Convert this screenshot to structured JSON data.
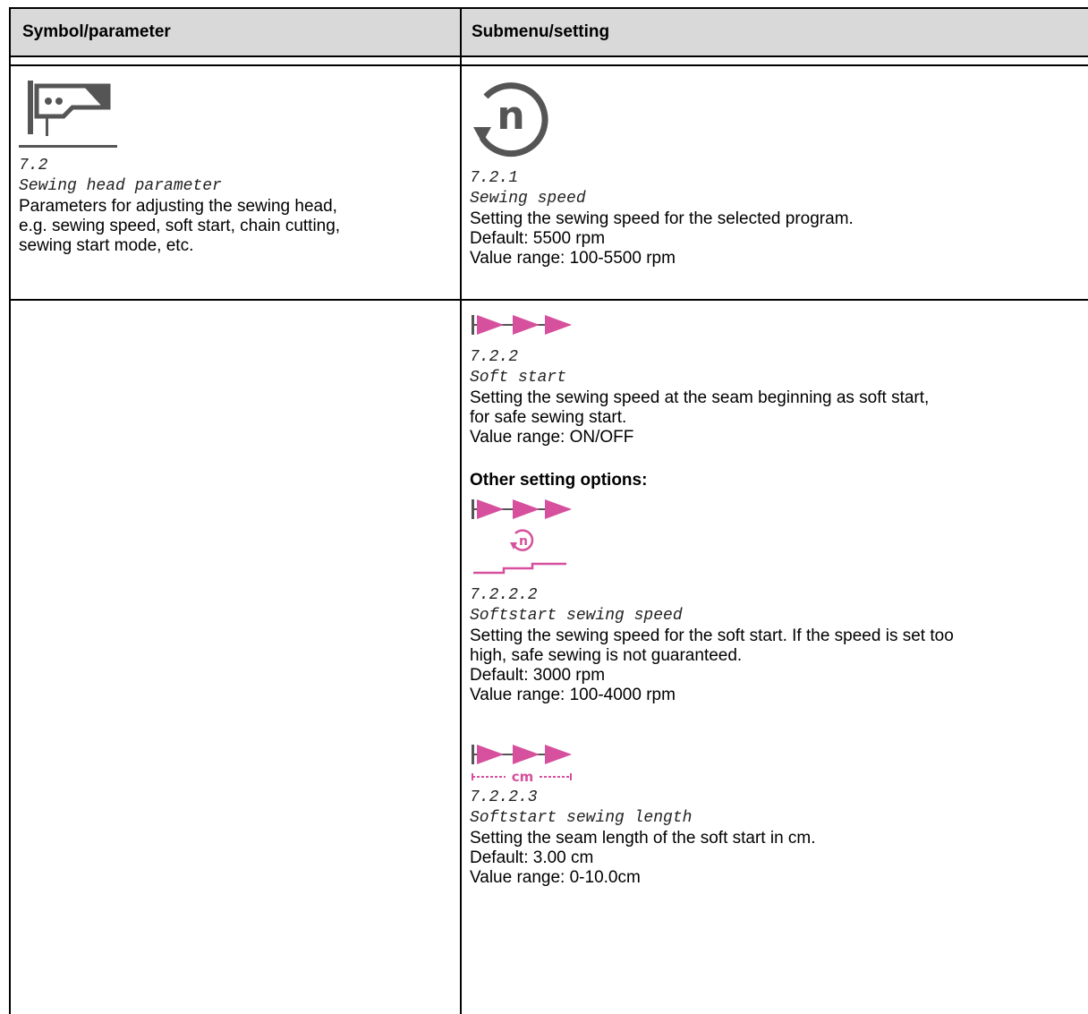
{
  "table": {
    "headers": [
      "Symbol/parameter",
      "Submenu/setting"
    ],
    "left": {
      "code": "7.2",
      "name": "Sewing head parameter",
      "description": [
        "Parameters for adjusting the sewing head,",
        "e.g. sewing speed, soft start, chain cutting,",
        "sewing start mode, etc."
      ],
      "icon": "sewing-head-icon"
    },
    "right": [
      {
        "code": "7.2.1",
        "name": "Sewing speed",
        "lines": [
          "Setting the sewing speed for the selected program.",
          "Default: 5500 rpm",
          "Value range: 100-5500 rpm"
        ],
        "icon": "sewing-speed-icon",
        "icon_text": "n"
      },
      {
        "code": "7.2.2",
        "name": "Soft start",
        "lines": [
          "Setting the sewing speed at the seam beginning as soft start,",
          "for safe sewing start.",
          "Value range: ON/OFF"
        ],
        "icon": "soft-start-icon"
      },
      {
        "heading": "Other setting options:"
      },
      {
        "code": "7.2.2.2",
        "name": "Softstart sewing speed",
        "lines": [
          "Setting the sewing speed for the soft start. If the speed is set too",
          "high, safe sewing is not guaranteed.",
          "Default: 3000 rpm",
          "Value range: 100-4000 rpm"
        ],
        "icon": "softstart-speed-icon",
        "icon_text": "n"
      },
      {
        "code": "7.2.2.3",
        "name": "Softstart sewing length",
        "lines": [
          "Setting the seam length of the soft start in cm.",
          "Default: 3.00 cm",
          "Value range: 0-10.0cm"
        ],
        "icon": "softstart-length-icon",
        "icon_text": "cm"
      }
    ]
  },
  "colors": {
    "header_bg": "#d9d9d9",
    "accent": "#d6509d",
    "icon_gray": "#555555"
  }
}
